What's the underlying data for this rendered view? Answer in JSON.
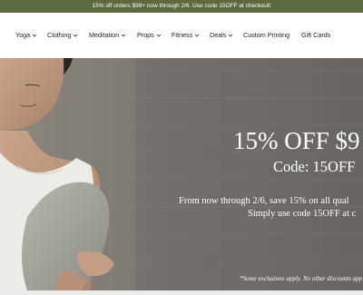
{
  "announcement": {
    "text": "15% off orders $99+ now through 2/6. Use code 15OFF at checkout!"
  },
  "nav": {
    "items": [
      {
        "label": "Yoga",
        "has_dropdown": true
      },
      {
        "label": "Clothing",
        "has_dropdown": true
      },
      {
        "label": "Meditation",
        "has_dropdown": true
      },
      {
        "label": "Props",
        "has_dropdown": true
      },
      {
        "label": "Fitness",
        "has_dropdown": true
      },
      {
        "label": "Deals",
        "has_dropdown": true
      },
      {
        "label": "Custom Printing",
        "has_dropdown": false
      },
      {
        "label": "Gift Cards",
        "has_dropdown": false
      }
    ]
  },
  "hero": {
    "title": "15% OFF $9",
    "subtitle": "Code: 15OFF",
    "body_line_1": "From now through 2/6, save 15% on all qual",
    "body_line_2": "Simply use code 15OFF at c",
    "disclaimer": "*Some exclusions apply. No other discounts app"
  },
  "colors": {
    "announcement_bg": "#5b6b3e",
    "hero_text": "#ffffff",
    "nav_text": "#222222"
  }
}
